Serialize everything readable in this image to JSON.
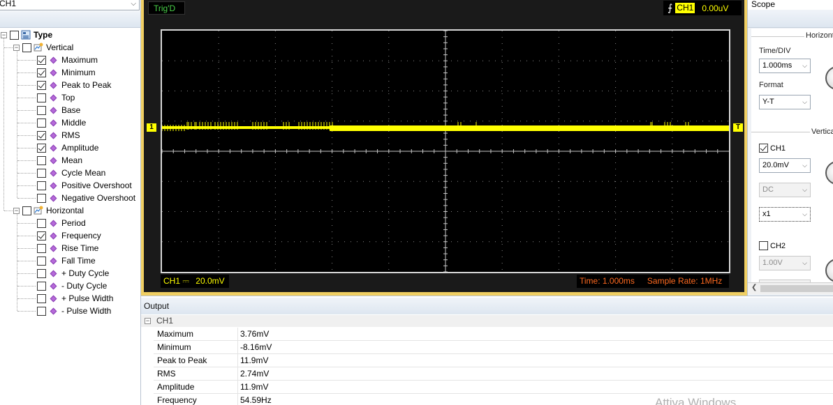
{
  "left_panel": {
    "channel_select": "CH1",
    "tree": {
      "root_label": "Type",
      "groups": [
        {
          "label": "Vertical",
          "items": [
            {
              "label": "Maximum",
              "checked": true
            },
            {
              "label": "Minimum",
              "checked": true
            },
            {
              "label": "Peak to Peak",
              "checked": true
            },
            {
              "label": "Top",
              "checked": false
            },
            {
              "label": "Base",
              "checked": false
            },
            {
              "label": "Middle",
              "checked": false
            },
            {
              "label": "RMS",
              "checked": true
            },
            {
              "label": "Amplitude",
              "checked": true
            },
            {
              "label": "Mean",
              "checked": false
            },
            {
              "label": "Cycle Mean",
              "checked": false
            },
            {
              "label": "Positive Overshoot",
              "checked": false
            },
            {
              "label": "Negative Overshoot",
              "checked": false
            }
          ]
        },
        {
          "label": "Horizontal",
          "items": [
            {
              "label": "Period",
              "checked": false
            },
            {
              "label": "Frequency",
              "checked": true
            },
            {
              "label": "Rise Time",
              "checked": false
            },
            {
              "label": "Fall Time",
              "checked": false
            },
            {
              "label": "+ Duty Cycle",
              "checked": false
            },
            {
              "label": "- Duty Cycle",
              "checked": false
            },
            {
              "label": "+ Pulse Width",
              "checked": false
            },
            {
              "label": "- Pulse Width",
              "checked": false
            }
          ]
        }
      ]
    }
  },
  "scope": {
    "trig_status": "Trig'D",
    "trigger_channel": "CH1",
    "trigger_level": "0.00uV",
    "channel_marker": "1",
    "trigger_marker": "T",
    "ch1_readout_label": "CH1",
    "ch1_coupling_symbol": "⎓",
    "ch1_volts_div": "20.0mV",
    "time_readout": "Time: 1.000ms",
    "sample_rate_readout": "Sample Rate: 1MHz",
    "trace_color": "#ffff00",
    "grid_color": "#8a8a8a"
  },
  "right_panel": {
    "title": "Scope",
    "horizontal_group": "Horizontal",
    "time_div_label": "Time/DIV",
    "time_div_value": "1.000ms",
    "format_label": "Format",
    "format_value": "Y-T",
    "vertical_group": "Vertical",
    "ch1_label": "CH1",
    "ch1_checked": true,
    "ch1_volts": "20.0mV",
    "ch1_coupling": "DC",
    "ch1_probe": "x1",
    "ch2_label": "CH2",
    "ch2_checked": false,
    "ch2_volts": "1.00V"
  },
  "output": {
    "title": "Output",
    "channel": "CH1",
    "rows": [
      {
        "name": "Maximum",
        "value": "3.76mV"
      },
      {
        "name": "Minimum",
        "value": "-8.16mV"
      },
      {
        "name": "Peak to Peak",
        "value": "11.9mV"
      },
      {
        "name": "RMS",
        "value": "2.74mV"
      },
      {
        "name": "Amplitude",
        "value": "11.9mV"
      },
      {
        "name": "Frequency",
        "value": "54.59Hz"
      }
    ]
  },
  "watermark": "Attiva Windows"
}
